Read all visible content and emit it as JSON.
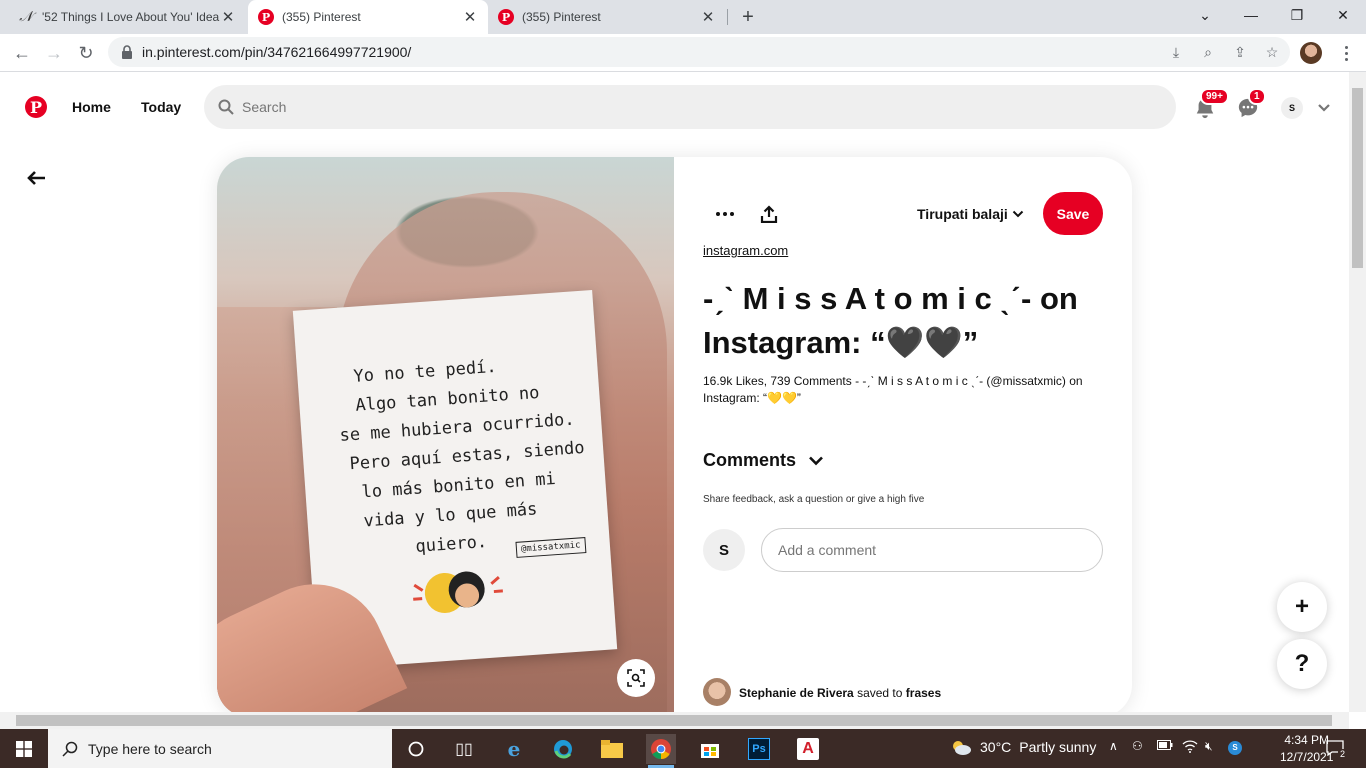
{
  "browser": {
    "tabs": [
      {
        "title": "'52 Things I Love About You' Idea",
        "icon": "n-favicon",
        "active": false
      },
      {
        "title": "(355) Pinterest",
        "icon": "pinterest-favicon",
        "active": true
      },
      {
        "title": "(355) Pinterest",
        "icon": "pinterest-favicon",
        "active": false
      }
    ],
    "url": "in.pinterest.com/pin/347621664997721900/"
  },
  "header": {
    "nav": {
      "home": "Home",
      "today": "Today"
    },
    "search_placeholder": "Search",
    "notifications_badge": "99+",
    "messages_badge": "1",
    "avatar_initial": "S"
  },
  "pin": {
    "board": "Tirupati balaji",
    "save_label": "Save",
    "source": "instagram.com",
    "title": "-ˏˋ M i s s A t o m i c ˎˊ- on Instagram: “🖤🖤”",
    "description": "16.9k Likes, 739 Comments - -ˏˋ M i s s A t o m i c ˎˊ- (@missatxmic) on Instagram: “💛💛”",
    "note_lines": [
      "Yo no te pedí.",
      "Algo tan bonito no",
      "se me hubiera ocurrido.",
      "Pero aquí estas, siendo",
      "lo más bonito en mi",
      "vida y lo que más",
      "quiero."
    ],
    "note_handle": "@missatxmic",
    "comments": {
      "heading": "Comments",
      "subtext": "Share feedback, ask a question or give a high five",
      "avatar_initial": "S",
      "input_placeholder": "Add a comment"
    },
    "saved_by": {
      "user": "Stephanie de Rivera",
      "verb": "saved to",
      "board": "frases"
    }
  },
  "floating": {
    "add": "+",
    "help": "?"
  },
  "taskbar": {
    "search_placeholder": "Type here to search",
    "temperature": "30°C",
    "weather": "Partly sunny",
    "time": "4:34 PM",
    "date": "12/7/2021",
    "notification_count": "2"
  },
  "colors": {
    "brand": "#e60023",
    "taskbar": "#3b2a26"
  }
}
